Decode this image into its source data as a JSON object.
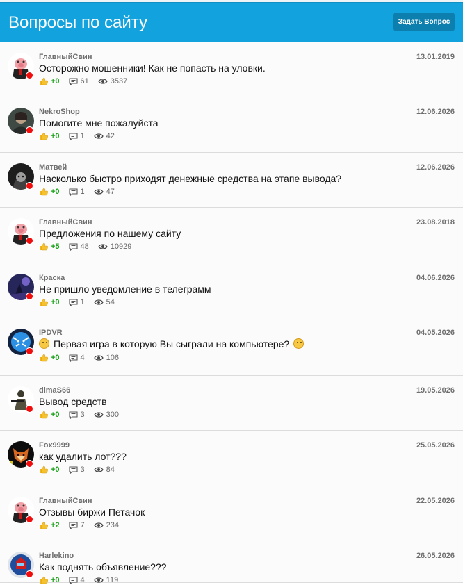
{
  "header": {
    "title": "Вопросы по сайту",
    "ask_button": "Задать Вопрос"
  },
  "colors": {
    "header": "#12a2dd",
    "button": "#0d7fae",
    "likes": "#1aa31a",
    "status_dot": "#f00d0d"
  },
  "items": [
    {
      "author": "ГлавныйСвин",
      "date": "13.01.2019",
      "title": "Осторожно мошенники! Как не попасть на уловки.",
      "likes": "+0",
      "comments": "61",
      "views": "3537",
      "avatar_icon": "pig-avatar-icon"
    },
    {
      "author": "NekroShop",
      "date": "12.06.2026",
      "title": "Помогите мне пожалуйста",
      "likes": "+0",
      "comments": "1",
      "views": "42",
      "avatar_icon": "dark-figure-avatar-icon"
    },
    {
      "author": "Матвей",
      "date": "12.06.2026",
      "title": "Насколько быстро приходят денежные средства на этапе вывода?",
      "likes": "+0",
      "comments": "1",
      "views": "47",
      "avatar_icon": "hooded-avatar-icon"
    },
    {
      "author": "ГлавныйСвин",
      "date": "23.08.2018",
      "title": "Предложения по нашему сайту",
      "likes": "+5",
      "comments": "48",
      "views": "10929",
      "avatar_icon": "pig-avatar-icon"
    },
    {
      "author": "Краска",
      "date": "04.06.2026",
      "title": "Не пришло уведомление в телеграмм",
      "likes": "+0",
      "comments": "1",
      "views": "54",
      "avatar_icon": "purple-scene-avatar-icon"
    },
    {
      "author": "IPDVR",
      "date": "04.05.2026",
      "title_emoji_before": "smile-emoji-icon",
      "title": "Первая игра в которую Вы сыграли на компьютере?",
      "title_emoji_after": "tongue-emoji-icon",
      "likes": "+0",
      "comments": "4",
      "views": "106",
      "avatar_icon": "blue-tiger-avatar-icon"
    },
    {
      "author": "dimaS66",
      "date": "19.05.2026",
      "title": "Вывод средств",
      "likes": "+0",
      "comments": "3",
      "views": "300",
      "avatar_icon": "soldier-avatar-icon"
    },
    {
      "author": "Fox9999",
      "date": "25.05.2026",
      "title": "как удалить лот???",
      "likes": "+0",
      "comments": "3",
      "views": "84",
      "avatar_icon": "fox-avatar-icon"
    },
    {
      "author": "ГлавныйСвин",
      "date": "22.05.2026",
      "title": "Отзывы биржи Петачок",
      "likes": "+2",
      "comments": "7",
      "views": "234",
      "avatar_icon": "pig-avatar-icon"
    },
    {
      "author": "Harlekino",
      "date": "26.05.2026",
      "title": "Как поднять объявление???",
      "likes": "+0",
      "comments": "4",
      "views": "119",
      "avatar_icon": "robot-avatar-icon"
    }
  ]
}
